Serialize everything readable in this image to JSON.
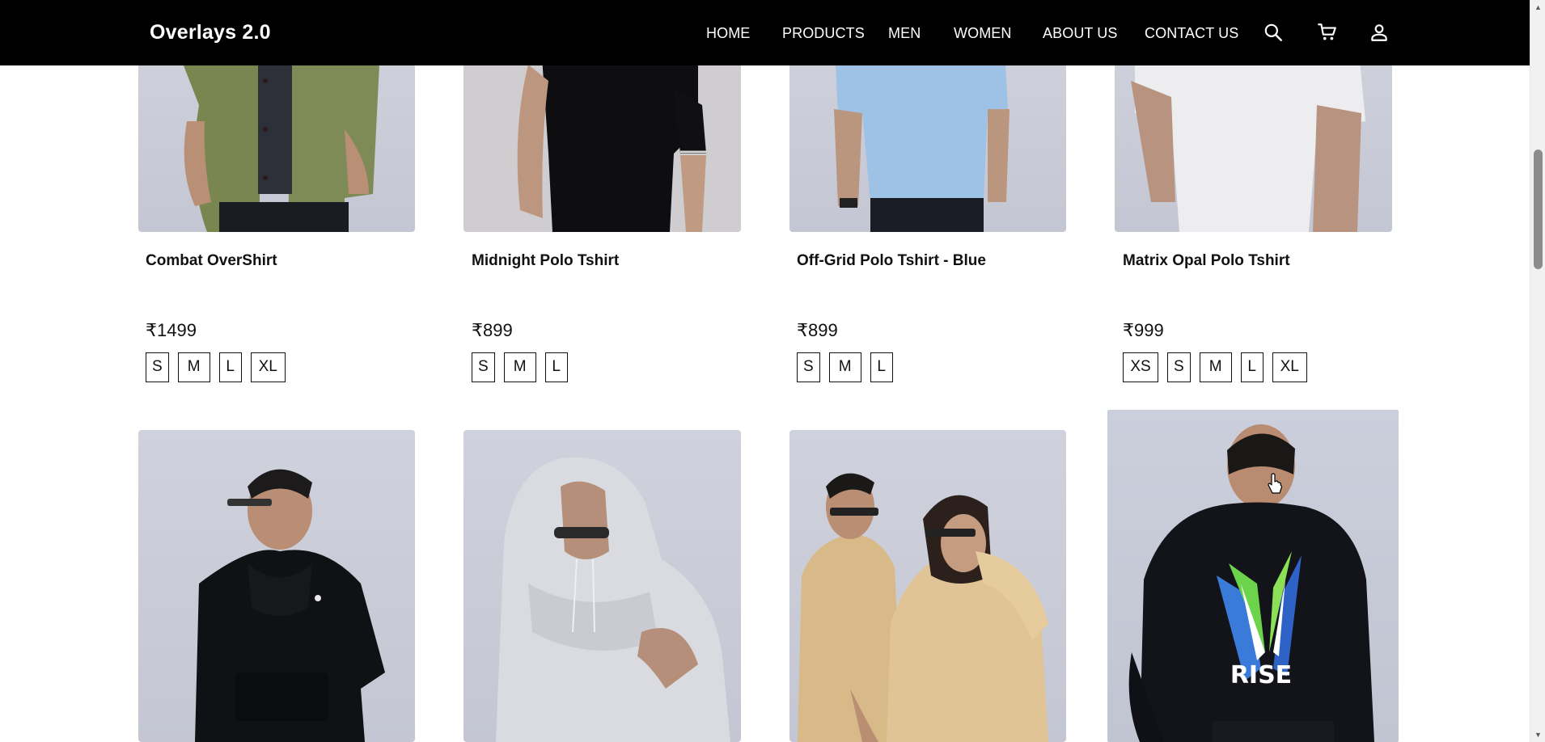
{
  "brand": "Overlays 2.0",
  "nav": {
    "links": [
      "HOME",
      "PRODUCTS",
      "MEN",
      "WOMEN",
      "ABOUT US",
      "CONTACT US"
    ],
    "icons": [
      "search-icon",
      "cart-icon",
      "account-icon"
    ]
  },
  "products_row1": [
    {
      "title": "Combat OverShirt",
      "price": "₹1499",
      "sizes": [
        "S",
        "M",
        "L",
        "XL"
      ],
      "photo": "olive-overshirt"
    },
    {
      "title": "Midnight Polo Tshirt",
      "price": "₹899",
      "sizes": [
        "S",
        "M",
        "L"
      ],
      "photo": "black-polo"
    },
    {
      "title": "Off-Grid Polo Tshirt - Blue",
      "price": "₹899",
      "sizes": [
        "S",
        "M",
        "L"
      ],
      "photo": "blue-polo"
    },
    {
      "title": "Matrix Opal Polo Tshirt",
      "price": "₹999",
      "sizes": [
        "XS",
        "S",
        "M",
        "L",
        "XL"
      ],
      "photo": "white-polo"
    }
  ],
  "products_row2": [
    {
      "photo": "black-hoodie"
    },
    {
      "photo": "grey-fur-hoodie"
    },
    {
      "photo": "beige-sherpa-pair"
    },
    {
      "photo": "black-rise-sweatshirt"
    }
  ],
  "print_text": "RISE",
  "colors": {
    "navbar": "#000000",
    "text": "#111111",
    "photo_bg": "#c8cad6"
  }
}
